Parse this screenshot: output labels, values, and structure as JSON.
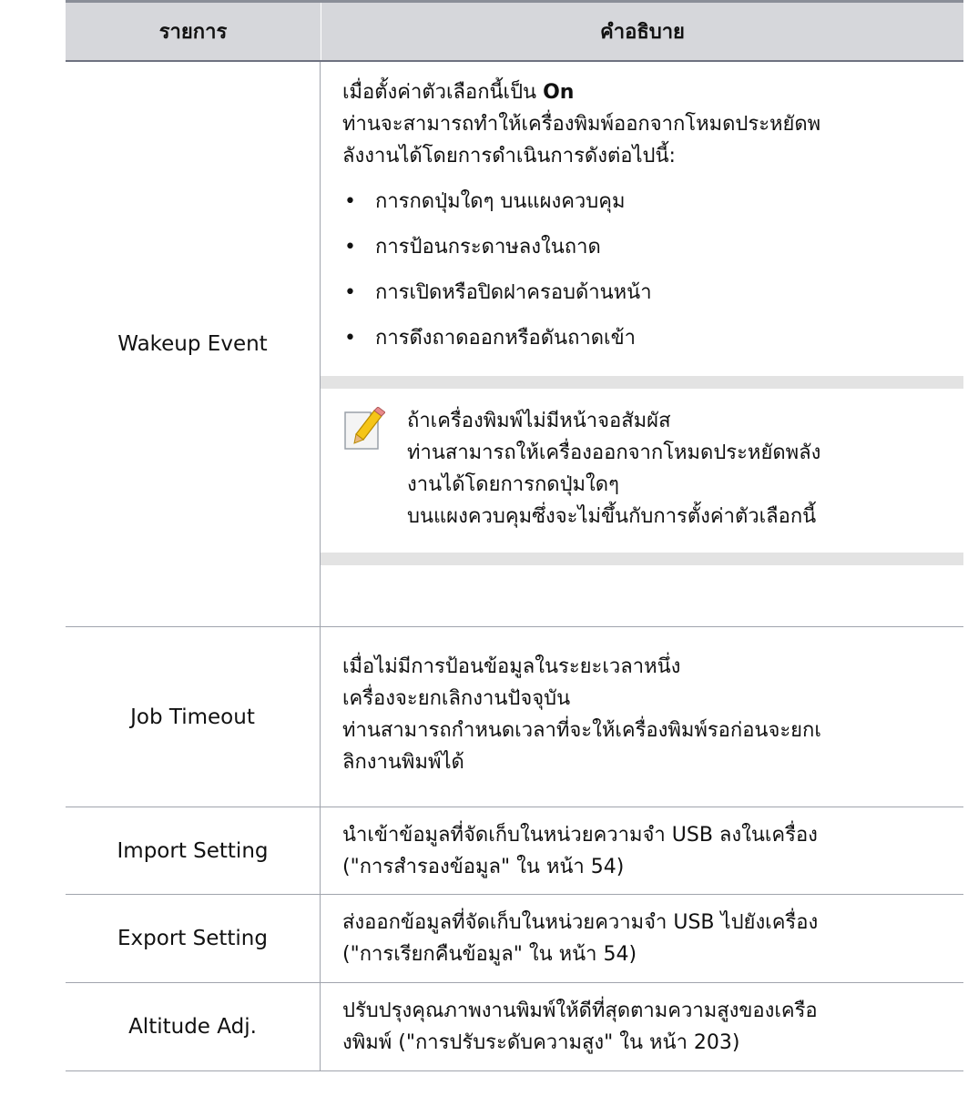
{
  "table": {
    "header": {
      "item": "รายการ",
      "description": "คำอธิบาย"
    },
    "wakeup": {
      "item": "Wakeup Event",
      "intro_prefix": "เมื่อตั้งค่าตัวเลือกนี้เป็น ",
      "intro_value": "On",
      "line2": "ท่านจะสามารถทำให้เครื่องพิมพ์ออกจากโหมดประหยัดพ",
      "line3": "ลังงานได้โดยการดำเนินการดังต่อไปนี้:",
      "bullets": [
        "การกดปุ่มใดๆ บนแผงควบคุม",
        "การป้อนกระดาษลงในถาด",
        "การเปิดหรือปิดฝาครอบด้านหน้า",
        "การดึงถาดออกหรือดันถาดเข้า"
      ],
      "note_icon": "note-pencil-icon",
      "note_lines": [
        "ถ้าเครื่องพิมพ์ไม่มีหน้าจอสัมผัส",
        "ท่านสามารถให้เครื่องออกจากโหมดประหยัดพลัง",
        "งานได้โดยการกดปุ่มใดๆ",
        "บนแผงควบคุมซึ่งจะไม่ขึ้นกับการตั้งค่าตัวเลือกนี้"
      ]
    },
    "job_timeout": {
      "item": "Job Timeout",
      "lines": [
        "เมื่อไม่มีการป้อนข้อมูลในระยะเวลาหนึ่ง",
        "เครื่องจะยกเลิกงานปัจจุบัน",
        "ท่านสามารถกำหนดเวลาที่จะให้เครื่องพิมพ์รอก่อนจะยกเ",
        "ลิกงานพิมพ์ได้"
      ]
    },
    "import_setting": {
      "item": "Import Setting",
      "lines": [
        "นำเข้าข้อมูลที่จัดเก็บในหน่วยความจำ USB ลงในเครื่อง",
        "(\"การสำรองข้อมูล\"  ใน  หน้า 54)"
      ]
    },
    "export_setting": {
      "item": "Export Setting",
      "lines": [
        "ส่งออกข้อมูลที่จัดเก็บในหน่วยความจำ USB ไปยังเครื่อง",
        "(\"การเรียกคืนข้อมูล\"  ใน  หน้า 54)"
      ]
    },
    "altitude": {
      "item": "Altitude Adj.",
      "lines": [
        "ปรับปรุงคุณภาพงานพิมพ์ให้ดีที่สุดตามความสูงของเครือ",
        "งพิมพ์ (\"การปรับระดับความสูง\"  ใน  หน้า 203)"
      ]
    }
  }
}
